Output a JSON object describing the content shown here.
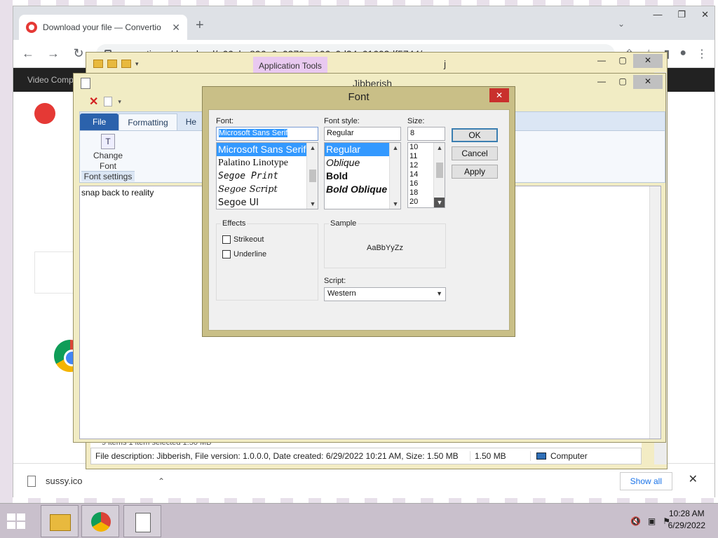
{
  "chrome": {
    "tab_title": "Download your file — Convertio",
    "url": "convertio.co/download/c66ebe896e6a0379cc100c0d24c61603df5744/",
    "site_header_text": "Video Comp"
  },
  "download_bar": {
    "file_name": "sussy.ico",
    "show_all_label": "Show all"
  },
  "explorer": {
    "app_tools_label": "Application Tools",
    "title": "j",
    "items_strip": "9 items    1 item selected  1.50 MB",
    "status_description": "File description: Jibberish, File version: 1.0.0.0, Date created: 6/29/2022 10:21 AM, Size: 1.50 MB",
    "status_size": "1.50 MB",
    "status_location": "Computer"
  },
  "jibberish": {
    "title": "Jibberish",
    "ribbon_tabs": {
      "file": "File",
      "formatting": "Formatting",
      "he": "He"
    },
    "change_font_line1": "Change",
    "change_font_line2": "Font",
    "group_label": "Font settings",
    "editor_text": "snap back to reality"
  },
  "font_dialog": {
    "title": "Font",
    "font_label": "Font:",
    "font_value": "Microsoft Sans Serif",
    "fonts": [
      "Microsoft Sans Serif",
      "Palatino Linotype",
      "Segoe Print",
      "Segoe Script",
      "Segoe UI"
    ],
    "style_label": "Font style:",
    "style_value": "Regular",
    "styles": [
      "Regular",
      "Oblique",
      "Bold",
      "Bold Oblique"
    ],
    "size_label": "Size:",
    "size_value": "8",
    "sizes": [
      "10",
      "11",
      "12",
      "14",
      "16",
      "18",
      "20"
    ],
    "ok_label": "OK",
    "cancel_label": "Cancel",
    "apply_label": "Apply",
    "effects_label": "Effects",
    "strikeout_label": "Strikeout",
    "underline_label": "Underline",
    "sample_label": "Sample",
    "sample_text": "AaBbYyZz",
    "script_label": "Script:",
    "script_value": "Western"
  },
  "taskbar": {
    "time": "10:28 AM",
    "date": "6/29/2022"
  }
}
